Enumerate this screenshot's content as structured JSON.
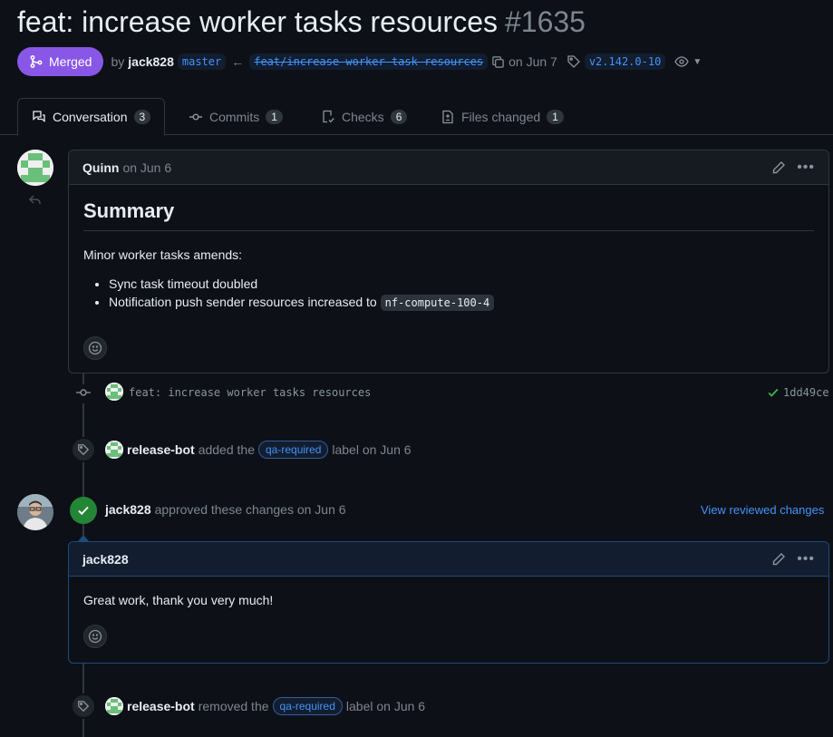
{
  "header": {
    "title": "feat: increase worker tasks resources",
    "number": "#1635",
    "state": "Merged",
    "by": "by",
    "author": "jack828",
    "base_branch": "master",
    "head_branch": "feat/increase-worker-task-resources",
    "merged_on": "on Jun 7",
    "release_tag": "v2.142.0-10"
  },
  "tabs": [
    {
      "label": "Conversation",
      "count": "3"
    },
    {
      "label": "Commits",
      "count": "1"
    },
    {
      "label": "Checks",
      "count": "6"
    },
    {
      "label": "Files changed",
      "count": "1"
    }
  ],
  "comment1": {
    "author": "Quinn",
    "when": "on Jun 6",
    "heading": "Summary",
    "intro": "Minor worker tasks amends:",
    "bullet1": "Sync task timeout doubled",
    "bullet2_text": "Notification push sender resources increased to",
    "bullet2_code": "nf-compute-100-4"
  },
  "commit": {
    "message": "feat: increase worker tasks resources",
    "sha": "1dd49ce"
  },
  "event1": {
    "actor": "release-bot",
    "pre": "added the",
    "label": "qa-required",
    "post": "label on Jun 6"
  },
  "review": {
    "actor": "jack828",
    "text": "approved these changes on Jun 6",
    "link": "View reviewed changes",
    "comment_author": "jack828",
    "comment_body": "Great work, thank you very much!"
  },
  "event2": {
    "actor": "release-bot",
    "pre": "removed the",
    "label": "qa-required",
    "post": "label on Jun 6"
  },
  "colors": {
    "merged": "#8957e5",
    "approved": "#238636",
    "link": "#4493f8",
    "background": "#0d1117"
  }
}
